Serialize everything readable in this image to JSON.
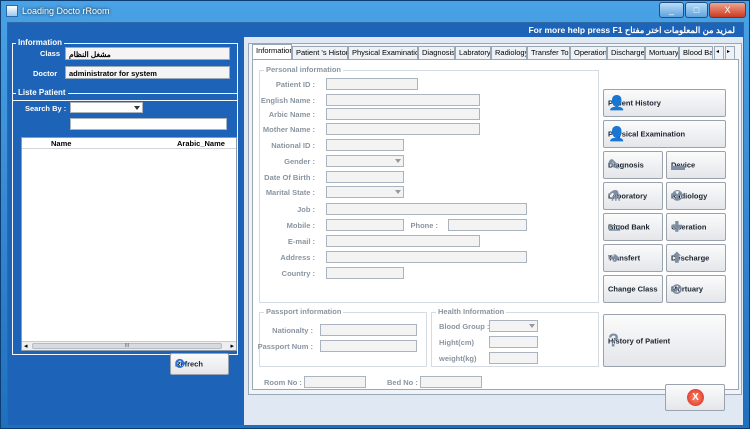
{
  "window": {
    "title": "Loading Docto rRoom",
    "minimize": "_",
    "maximize": "□",
    "close": "X"
  },
  "help": {
    "text": "For more help press F1  لمزيد من المعلومات اختر مفتاح"
  },
  "information": {
    "title": "Information",
    "class_label": "Class",
    "class_value": "مشغل النظام",
    "doctor_label": "Doctor",
    "doctor_value": "administrator for system"
  },
  "patients": {
    "title": "Liste Patient",
    "search_label": "Search By :",
    "col_name": "Name",
    "col_arabic": "Arabic_Name",
    "scroll_mid": "III"
  },
  "refresh": {
    "label": "Refrech"
  },
  "tabs": [
    "Information",
    "Patient 's History",
    "Physical Examination",
    "Diagnosis",
    "Labratory",
    "Radiology",
    "Transfer To",
    "Operation",
    "Discharge",
    "Mortuary",
    "Blood Bank"
  ],
  "personal": {
    "title": "Personal information",
    "patient_id": "Patient ID :",
    "english_name": "English Name :",
    "arabic_name": "Arbic Name :",
    "mother_name": "Mother Name :",
    "national_id": "National ID :",
    "gender": "Gender :",
    "dob": "Date Of Birth :",
    "marital": "Marital State :",
    "job": "Job :",
    "mobile": "Mobile :",
    "phone": "Phone :",
    "email": "E-mail :",
    "address": "Address :",
    "country": "Country :"
  },
  "passport": {
    "title": "Passport information",
    "nationality": "Nationalty :",
    "passport_num": "Passport Num :"
  },
  "health": {
    "title": "Health Information",
    "blood_group": "Blood Group :",
    "height": "Hight(cm)",
    "weight": "weight(kg)"
  },
  "room": {
    "room_no": "Room No :",
    "bed_no": "Bed No :"
  },
  "actions": {
    "patient_history": "Patient History",
    "physical_exam": "Physical Examination",
    "diagnosis": "Diagnosis",
    "device": "Device",
    "laboratory": "Laboratory",
    "radiology": "Radiology",
    "blood_bank": "Blood Bank",
    "operation": "Operation",
    "transfert": "Transfert",
    "descharge": "Descharge",
    "change_class": "Change Class",
    "mortuary": "Mortuary",
    "history_patient": "History of  Patient"
  },
  "scroll": {
    "left": "◂",
    "right": "▸"
  }
}
